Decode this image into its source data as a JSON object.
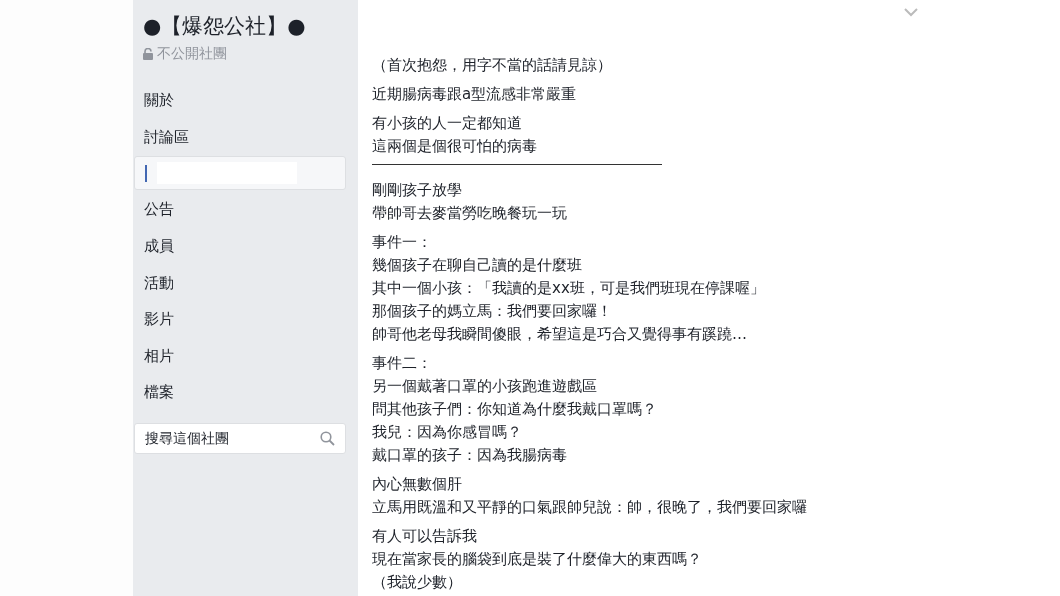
{
  "group": {
    "title": "●【爆怨公社】●",
    "privacy": "不公開社團"
  },
  "sidebar": {
    "items": [
      {
        "label": "關於",
        "selected": false
      },
      {
        "label": "討論區",
        "selected": false
      },
      {
        "kind": "redacted",
        "selected": true
      },
      {
        "label": "公告",
        "selected": false
      },
      {
        "label": "成員",
        "selected": false
      },
      {
        "label": "活動",
        "selected": false
      },
      {
        "label": "影片",
        "selected": false
      },
      {
        "label": "相片",
        "selected": false
      },
      {
        "label": "檔案",
        "selected": false
      }
    ],
    "search": {
      "placeholder": "搜尋這個社團"
    }
  },
  "post": {
    "paragraphs": [
      {
        "lines": [
          "（首次抱怨，用字不當的話請見諒）"
        ]
      },
      {
        "lines": [
          "近期腸病毒跟a型流感非常嚴重"
        ]
      },
      {
        "lines": [
          "有小孩的人一定都知道",
          "這兩個是個很可怕的病毒"
        ]
      },
      {
        "kind": "rule"
      },
      {
        "lines": [
          "剛剛孩子放學",
          "帶帥哥去麥當勞吃晚餐玩一玩"
        ]
      },
      {
        "lines": [
          "事件一：",
          "幾個孩子在聊自己讀的是什麼班",
          "其中一個小孩：「我讀的是xx班，可是我們班現在停課喔」",
          "那個孩子的媽立馬：我們要回家囉！",
          "帥哥他老母我瞬間傻眼，希望這是巧合又覺得事有蹊蹺…"
        ]
      },
      {
        "lines": [
          "事件二：",
          "另一個戴著口罩的小孩跑進遊戲區",
          "問其他孩子們：你知道為什麼我戴口罩嗎？",
          "我兒：因為你感冒嗎？",
          "戴口罩的孩子：因為我腸病毒"
        ]
      },
      {
        "lines": [
          "內心無數個肝",
          "立馬用既溫和又平靜的口氣跟帥兒說：帥，很晚了，我們要回家囉"
        ]
      },
      {
        "lines": [
          "有人可以告訴我",
          "現在當家長的腦袋到底是裝了什麼偉大的東西嗎？",
          "（我說少數）"
        ]
      }
    ]
  }
}
